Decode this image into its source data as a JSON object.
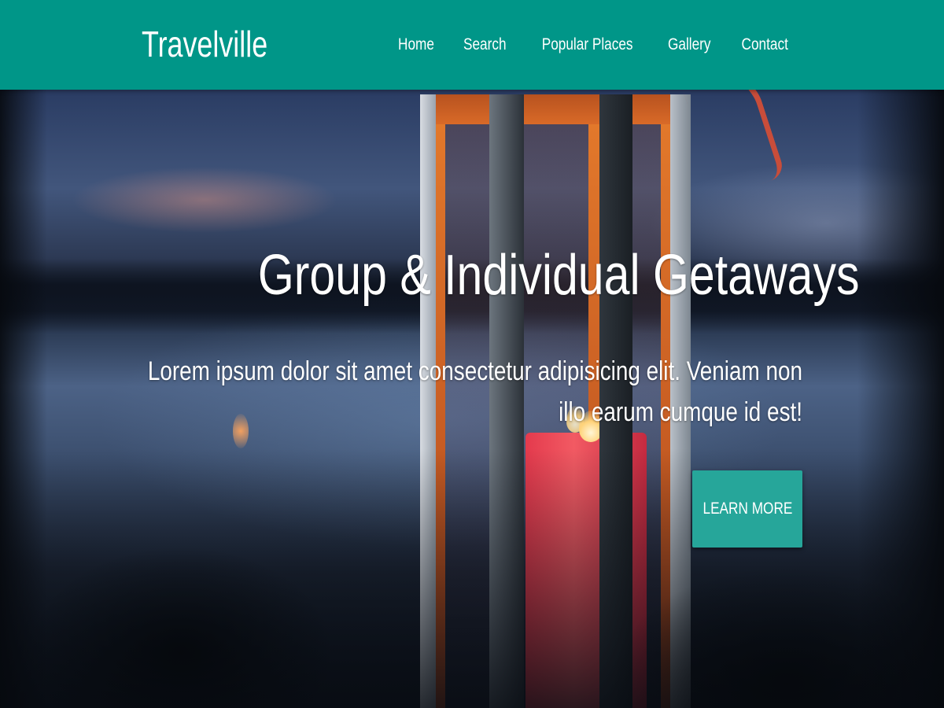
{
  "header": {
    "brand": "Travelville",
    "nav": [
      {
        "label": "Home"
      },
      {
        "label": "Search"
      },
      {
        "label": "Popular Places"
      },
      {
        "label": "Gallery"
      },
      {
        "label": "Contact"
      }
    ]
  },
  "hero": {
    "title": "Group & Individual Getaways",
    "text": "Lorem ipsum dolor sit amet consectetur adipisicing elit. Veniam non illo earum cumque id est!",
    "button_label": "LEARN MORE",
    "background_image": "lantern-with-candle-by-lake-at-dusk"
  },
  "colors": {
    "navbar": "#009688",
    "button": "#26a69a",
    "text": "#ffffff"
  }
}
